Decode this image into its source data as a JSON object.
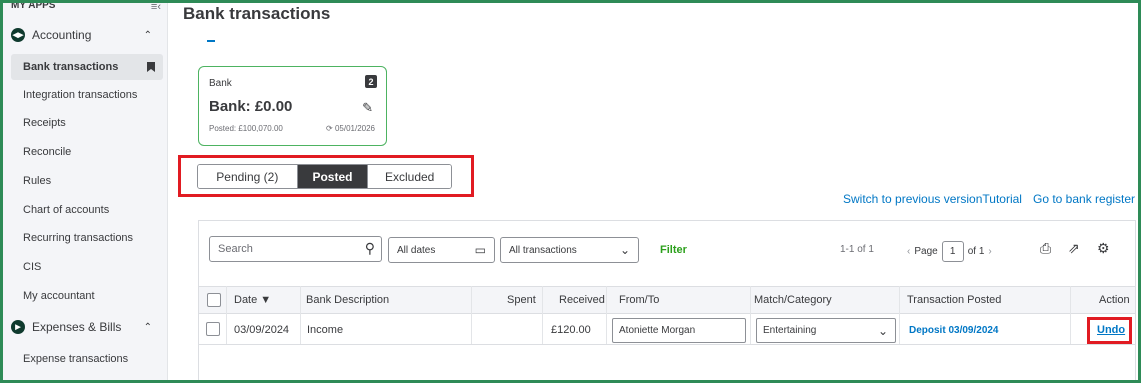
{
  "sidebar": {
    "my_apps": "MY APPS",
    "sections": [
      {
        "label": "Accounting",
        "icon": "accounting-logo-icon"
      },
      {
        "label": "Expenses & Bills",
        "icon": "expenses-logo-icon"
      }
    ],
    "accounting_items": [
      {
        "label": "Bank transactions",
        "active": true
      },
      {
        "label": "Integration transactions"
      },
      {
        "label": "Receipts"
      },
      {
        "label": "Reconcile"
      },
      {
        "label": "Rules"
      },
      {
        "label": "Chart of accounts"
      },
      {
        "label": "Recurring transactions"
      },
      {
        "label": "CIS"
      },
      {
        "label": "My accountant"
      }
    ],
    "expense_items": [
      {
        "label": "Expense transactions"
      }
    ]
  },
  "page": {
    "title": "Bank transactions"
  },
  "bank_card": {
    "label": "Bank",
    "badge": "2",
    "balance": "Bank: £0.00",
    "posted": "Posted: £100,070.00",
    "updated": "05/01/2026"
  },
  "tabs": [
    {
      "label": "Pending (2)",
      "selected": false
    },
    {
      "label": "Posted",
      "selected": true
    },
    {
      "label": "Excluded",
      "selected": false
    }
  ],
  "links": {
    "switch_version": "Switch to previous versionTutorial",
    "bank_register": "Go to bank register"
  },
  "toolbar": {
    "search_placeholder": "Search",
    "date_filter": "All dates",
    "type_filter": "All transactions",
    "filter_label": "Filter",
    "count": "1-1 of 1",
    "page_label": "Page",
    "page_value": "1",
    "page_of": "of 1"
  },
  "table": {
    "columns": [
      "Date ▼",
      "Bank Description",
      "Spent",
      "Received",
      "From/To",
      "Match/Category",
      "Transaction Posted",
      "Action"
    ],
    "rows": [
      {
        "date": "03/09/2024",
        "description": "Income",
        "spent": "",
        "received": "£120.00",
        "from_to": "Atoniette Morgan",
        "category": "Entertaining",
        "posted": "Deposit 03/09/2024",
        "action": "Undo"
      }
    ]
  },
  "colors": {
    "highlight": "#e11b22",
    "frame": "#2e8b57",
    "link": "#0077c5",
    "filter": "#2ca01c"
  }
}
